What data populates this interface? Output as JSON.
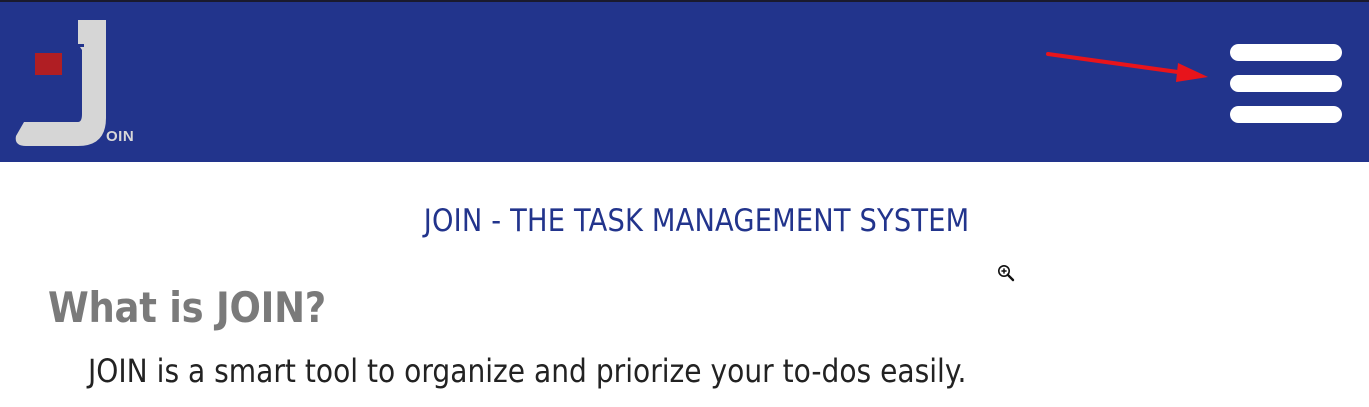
{
  "header": {
    "logo_text": "OIN",
    "colors": {
      "background": "#22348c",
      "logo_accent": "#b01e23",
      "logo_letter": "#d6d6d6",
      "menu_bars": "#ffffff",
      "annotation_arrow": "#e8141b"
    },
    "menu_icon": "hamburger-menu-icon"
  },
  "main": {
    "subtitle": "JOIN - THE TASK MANAGEMENT SYSTEM",
    "heading": "What is JOIN?",
    "description": "JOIN is a smart tool to organize and priorize your to-dos easily."
  }
}
